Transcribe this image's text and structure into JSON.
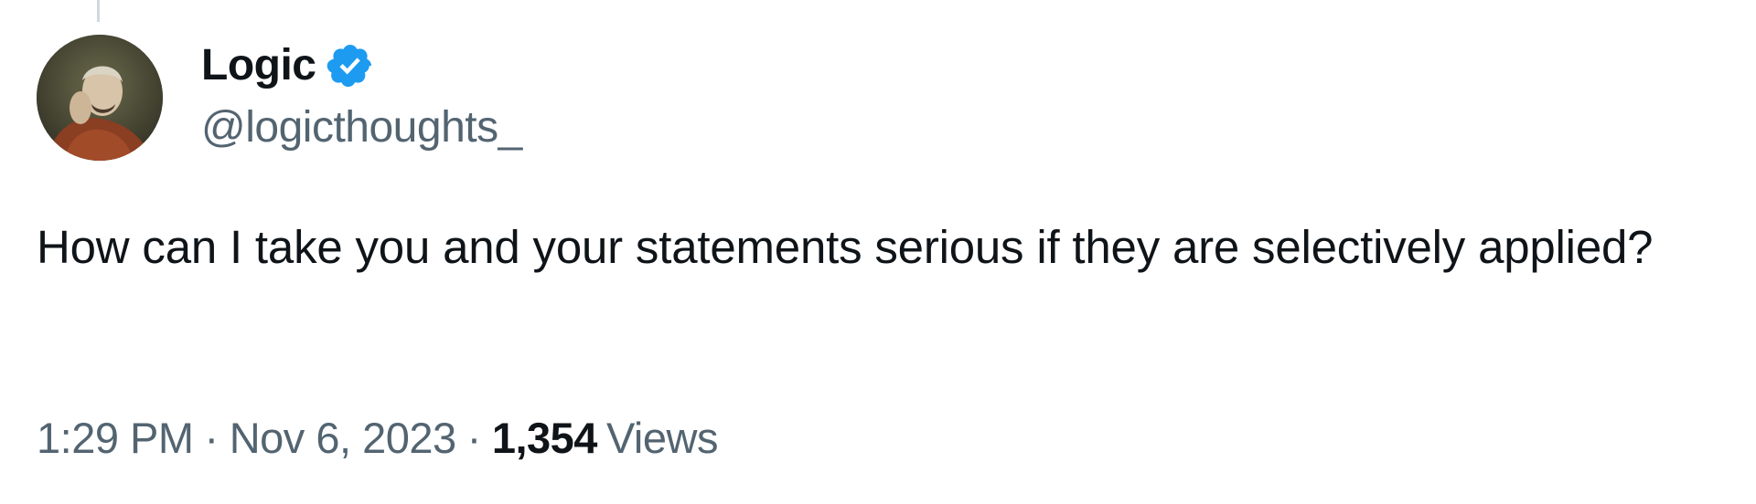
{
  "tweet": {
    "author": {
      "display_name": "Logic",
      "handle": "@logicthoughts_",
      "verified": true,
      "avatar_icon": "user-avatar-photo"
    },
    "text": "How can I take you and your statements serious if they are selectively applied?",
    "time": "1:29 PM",
    "date": "Nov 6, 2023",
    "separator": "·",
    "views_count": "1,354",
    "views_label": "Views"
  },
  "colors": {
    "text_primary": "#0f1419",
    "text_secondary": "#536471",
    "verified_blue": "#1d9bf0",
    "thread_line": "#cfd9de"
  }
}
